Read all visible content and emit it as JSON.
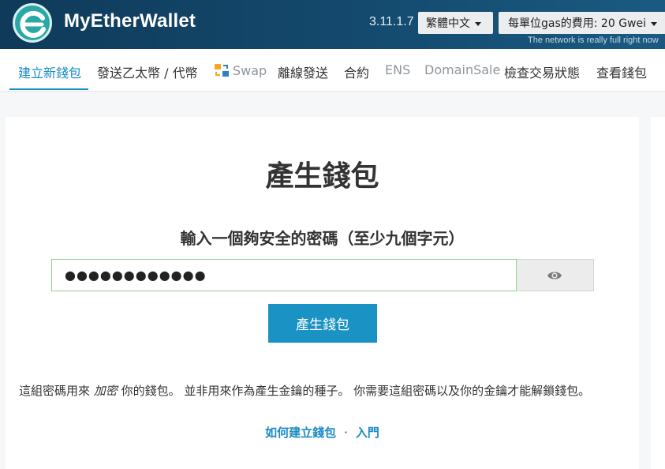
{
  "header": {
    "brand": "MyEtherWallet",
    "version": "3.11.1.7",
    "language": "繁體中文",
    "gas": "每單位gas的費用: 20 Gwei",
    "network_note": "The network is really full right now"
  },
  "nav": {
    "items": [
      {
        "label": "建立新錢包",
        "state": "active"
      },
      {
        "label": "發送乙太幣 / 代幣",
        "state": "normal"
      },
      {
        "label": "Swap",
        "state": "muted",
        "icon": "swap-icon"
      },
      {
        "label": "離線發送",
        "state": "normal"
      },
      {
        "label": "合約",
        "state": "normal"
      },
      {
        "label": "ENS",
        "state": "muted"
      },
      {
        "label": "DomainSale",
        "state": "muted"
      },
      {
        "label": "檢查交易狀態",
        "state": "normal"
      },
      {
        "label": "查看錢包",
        "state": "normal"
      }
    ]
  },
  "main": {
    "title": "產生錢包",
    "prompt": "輸入一個夠安全的密碼（至少九個字元）",
    "password_value": "●●●●●●●●●●●●",
    "generate_label": "產生錢包",
    "note_before": "這組密碼用來 ",
    "note_em": "加密",
    "note_after": " 你的錢包。 並非用來作為產生金鑰的種子。 你需要這組密碼以及你的金鑰才能解鎖錢包。",
    "link_how": "如何建立錢包",
    "link_sep": "·",
    "link_start": "入門"
  },
  "colors": {
    "accent": "#1a8bc4",
    "button": "#1a93c4",
    "header_bg": "#144a6e",
    "valid_border": "#8fd48c"
  }
}
